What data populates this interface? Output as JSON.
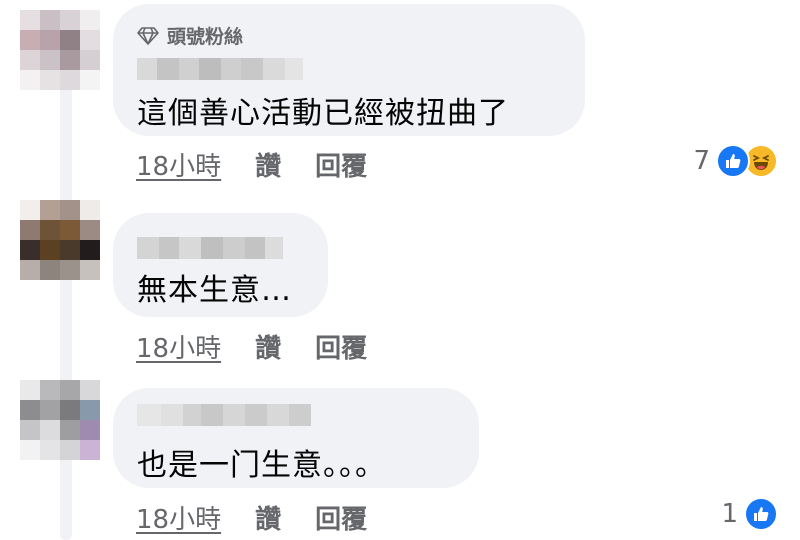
{
  "comments": [
    {
      "badge": "頭號粉絲",
      "text": "這個善心活動已經被扭曲了",
      "time": "18小時",
      "like_label": "讚",
      "reply_label": "回覆",
      "reaction_count": "7",
      "reactions": [
        "like-icon",
        "haha-icon"
      ]
    },
    {
      "text": "無本生意…",
      "time": "18小時",
      "like_label": "讚",
      "reply_label": "回覆"
    },
    {
      "text": "也是一门生意。。。",
      "time": "18小時",
      "like_label": "讚",
      "reply_label": "回覆",
      "reaction_count": "1",
      "reactions": [
        "like-icon"
      ]
    }
  ],
  "colors": {
    "bubble": "#f0f2f5",
    "meta_text": "#65676b",
    "like_blue": "#1877f2",
    "haha_yellow": "#f7b928"
  }
}
